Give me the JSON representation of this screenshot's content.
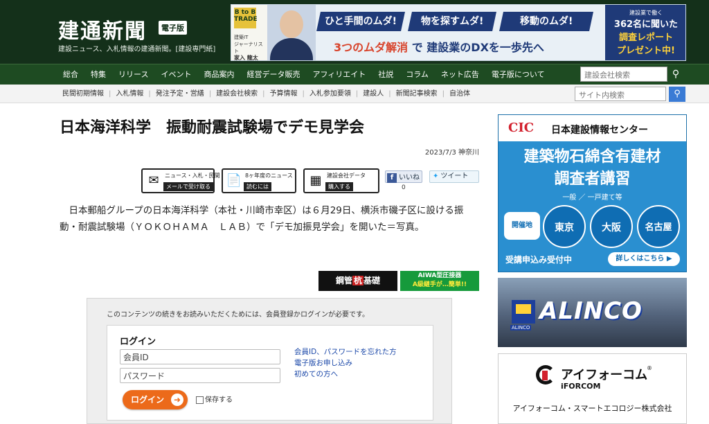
{
  "site": {
    "logo": "建通新聞",
    "edition_badge": "電子版",
    "tagline": "建設ニュース、入札情報の建通新聞。[建設専門紙]"
  },
  "top_banner": {
    "btob": "B to B TRADE",
    "small1": "建築IT",
    "small2": "ジャーナリスト",
    "small3": "家入 龍太",
    "pills": [
      "ひと手間のムダ!",
      "物を探すムダ!",
      "移動のムダ!"
    ],
    "main_prefix": "3つのムダ解消",
    "main_mid": " で ",
    "main_suffix": "建設業のDXを一歩先へ",
    "right1": "建設業で働く",
    "right2": "362名に聞いた",
    "right3": "調査レポート",
    "right4": "プレゼント中!"
  },
  "nav_main": {
    "items": [
      "総合",
      "特集",
      "リリース",
      "イベント",
      "商品案内",
      "経営データ販売",
      "アフィリエイト",
      "社説",
      "コラム",
      "ネット広告",
      "電子版について"
    ],
    "search_placeholder": "建設会社検索"
  },
  "nav_sub": {
    "items": [
      "民間初期情報",
      "入札情報",
      "発注予定・営繕",
      "建設会社検索",
      "予算情報",
      "入札参加要領",
      "建設人",
      "新聞記事検索",
      "自治体"
    ],
    "search_placeholder": "サイト内検索"
  },
  "article": {
    "title": "日本海洋科学　振動耐震試験場でデモ見学会",
    "date": "2023/7/3",
    "region": "神奈川",
    "body": "日本郵船グループの日本海洋科学（本社・川崎市幸区）は６月29日、横浜市磯子区に設ける振動・耐震試験場（ＹＯＫＯＨＡＭＡ　ＬＡＢ）で「デモ加振見学会」を開いた＝写真。"
  },
  "actions": [
    {
      "top": "ニュース・入札・民間",
      "bottom": "メールで受け取る"
    },
    {
      "top": "8ヶ年度のニュース",
      "bottom": "読むには"
    },
    {
      "top": "建設会社データ",
      "bottom": "購入する"
    }
  ],
  "social": {
    "like": "いいね",
    "like_count": "0",
    "tweet": "ツイート"
  },
  "small_ads": {
    "ad1_pre": "鋼管",
    "ad1_mid": "杭",
    "ad1_post": "基礎",
    "ad2_l1": "AIWA型圧接器",
    "ad2_l2": "A級継手が…簡単!!"
  },
  "login": {
    "note": "このコンテンツの続きをお読みいただくためには、会員登録かログインが必要です。",
    "title": "ログイン",
    "id_placeholder": "会員ID",
    "password_placeholder": "パスワード",
    "links": [
      "会員ID、パスワードを忘れた方",
      "電子版お申し込み",
      "初めての方へ"
    ],
    "button": "ログイン",
    "remember": "保存する"
  },
  "sidebar": {
    "cic_logo": "CIC",
    "cic_name": "日本建設情報センター",
    "course_title1": "建築物石綿含有建材",
    "course_title2": "調査者講習",
    "course_sub": "一般 ／ 一戸建て等",
    "venue_label": "開催地",
    "venues": [
      "東京",
      "大阪",
      "名古屋"
    ],
    "cta": "受講申込み受付中",
    "more": "詳しくはこちら ▶",
    "alinco": "ALINCO",
    "alinco_small": "ALINCO",
    "iforcom_name": "アイフォーコム",
    "iforcom_en": "iFORCOM",
    "iforcom_reg": "®",
    "iforcom_company": "アイフォーコム・スマートエコロジー株式会社"
  },
  "colors": {
    "header_bg": "#14301a",
    "nav_bg": "#1e4b22",
    "login_button": "#ec6a1a",
    "search_button": "#3a7bd5",
    "cic_blue": "#2a8fd0"
  }
}
